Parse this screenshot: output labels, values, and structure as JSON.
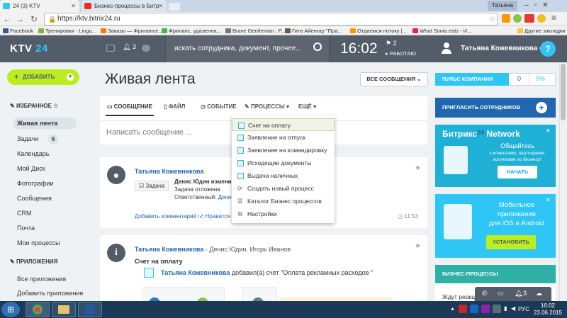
{
  "browser": {
    "user_badge": "Татьяна",
    "tabs": [
      {
        "label": "24 (3) KTV",
        "fav_color": "#2fc6f6"
      },
      {
        "label": "Бизнес-процессы в Битр",
        "fav_color": "#e52d27"
      }
    ],
    "url": "https://ktv.bitrix24.ru",
    "bookmarks": [
      {
        "label": "Facebook",
        "color": "#3b5998"
      },
      {
        "label": "Тренировки - Lingu...",
        "color": "#7cb342"
      },
      {
        "label": "Заказы — Фрилансе...",
        "color": "#f57c00"
      },
      {
        "label": "Фриланс, удаленна...",
        "color": "#4caf50"
      },
      {
        "label": "Brave Gentleman : P...",
        "color": "#777777"
      },
      {
        "label": "Гита Айенгар \"Пра...",
        "color": "#795548"
      },
      {
        "label": "Отдаемся потоку |...",
        "color": "#ff9800"
      },
      {
        "label": "What Sonia eats - И...",
        "color": "#e91e63"
      },
      {
        "label": "Другие закладки",
        "color": "#f4c542"
      }
    ]
  },
  "header": {
    "logo_text": "KTV",
    "logo_num": "24",
    "notif_count": "3",
    "search_placeholder": "искать сотрудника, документ, прочее...",
    "clock": "16:02",
    "tasks_count": "2",
    "status": "РАБОТАЮ",
    "user_name": "Татьяна Кожевникова",
    "help": "?"
  },
  "sidebar": {
    "add_label": "ДОБАВИТЬ",
    "favorites_label": "ИЗБРАННОЕ",
    "items": [
      {
        "label": "Живая лента"
      },
      {
        "label": "Задачи",
        "badge": "6"
      },
      {
        "label": "Календарь"
      },
      {
        "label": "Мой Диск"
      },
      {
        "label": "Фотографии"
      },
      {
        "label": "Сообщения"
      },
      {
        "label": "CRM"
      },
      {
        "label": "Почта"
      },
      {
        "label": "Мои процессы"
      }
    ],
    "apps_label": "ПРИЛОЖЕНИЯ",
    "app_items": [
      {
        "label": "Все приложения"
      },
      {
        "label": "Добавить приложение"
      }
    ]
  },
  "main": {
    "title": "Живая лента",
    "filter_label": "ВСЕ СООБЩЕНИЯ",
    "composer": {
      "tabs": [
        "СООБЩЕНИЕ",
        "ФАЙЛ",
        "СОБЫТИЕ",
        "ПРОЦЕССЫ",
        "ЕЩЁ"
      ],
      "placeholder": "Написать сообщение ..."
    },
    "post1": {
      "author": "Татьяна Кожевникова",
      "tag": "Задача",
      "line1": "Денис Юдин изменил",
      "line2": "Задача отложена",
      "line3_label": "Ответственный:",
      "line3_value": "Денис",
      "add_comment": "Добавить комментарий",
      "like": "Нравится",
      "time": "11:53"
    },
    "post2": {
      "author": "Татьяна Кожевникова",
      "arrow": "›",
      "recipients": "Денис Юдин, Игорь Иванов",
      "subject": "Счет на оплату",
      "sub_author": "Татьяна Кожевникова",
      "sub_text": "добавил(а) счет \"Оплата рекламных расходов \""
    }
  },
  "dropdown": {
    "items": [
      "Счет на оплату",
      "Заявление на отпуск",
      "Заявление на командировку",
      "Исходящие документы",
      "Выдача наличных",
      "Создать новый процесс",
      "Каталог Бизнес процессов",
      "Настройки"
    ]
  },
  "right": {
    "pulse_label": "ПУЛЬС КОМПАНИИ",
    "pulse_value": "0",
    "pulse_percent": "0%",
    "invite_label": "ПРИГЛАСИТЬ СОТРУДНИКОВ",
    "network_title": "Битрикс",
    "network_num": "24",
    "network_word": "Network",
    "network_text1": "Общайтесь",
    "network_text2": "с клиентами, партнерами,",
    "network_text3": "коллегами по бизнесу!",
    "network_btn": "НАЧАТЬ",
    "mobile_line1": "Мобильное",
    "mobile_line2": "приложение",
    "mobile_line3": "для iOS и Android",
    "mobile_btn": "УСТАНОВИТЬ",
    "bp_label": "БИЗНЕС-ПРОЦЕССЫ",
    "bp_body": "Ждут реакц"
  },
  "chatbar": {
    "count": "3"
  },
  "taskbar": {
    "lang": "РУС",
    "time": "16:02",
    "date": "23.06.2015"
  }
}
